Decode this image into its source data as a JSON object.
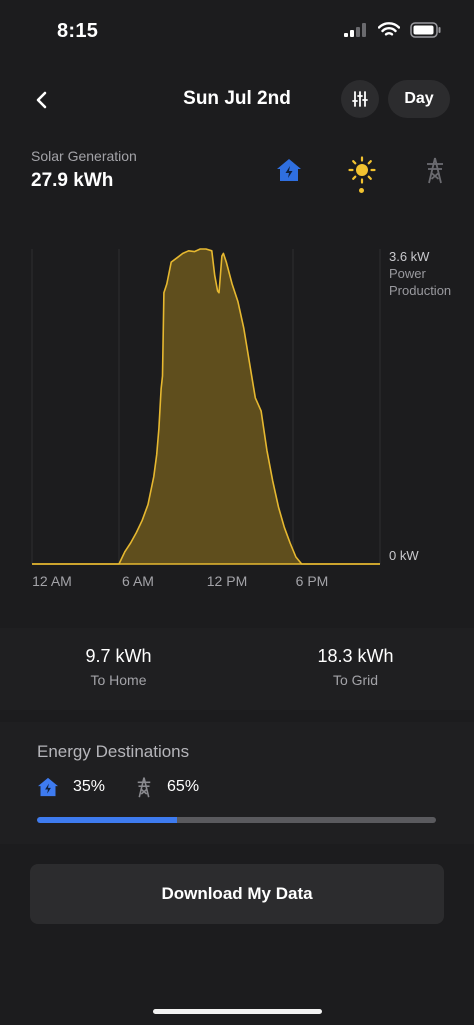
{
  "status_bar": {
    "time": "8:15"
  },
  "nav": {
    "title": "Sun Jul 2nd",
    "period_label": "Day"
  },
  "generation": {
    "label": "Solar Generation",
    "value": "27.9 kWh"
  },
  "chart_data": {
    "type": "area",
    "title": "",
    "xlabel": "",
    "ylabel": "Power Production",
    "x_ticks": [
      "12 AM",
      "6 AM",
      "12 PM",
      "6 PM"
    ],
    "y_ticks": [
      "0 kW",
      "3.6 kW"
    ],
    "ylim": [
      0,
      3.6
    ],
    "xlim": [
      0,
      24
    ],
    "grid": true,
    "colors": {
      "line": "#e6b830",
      "fill": "#5f4e1d",
      "grid": "#2e2e30"
    },
    "series": [
      {
        "x": [
          0,
          6.0,
          6.4,
          6.8,
          7.2,
          7.6,
          8.0,
          8.4,
          8.6,
          8.75,
          8.9,
          9.0,
          9.1,
          9.3,
          9.6,
          10.0,
          10.4,
          10.8,
          11.2,
          11.6,
          12.0,
          12.4,
          12.6,
          12.8,
          12.9,
          13.1,
          13.2,
          13.4,
          13.8,
          14.2,
          14.6,
          15.0,
          15.4,
          15.8,
          16.2,
          16.6,
          17.0,
          17.4,
          17.8,
          18.2,
          18.6,
          19.0,
          24
        ],
        "y": [
          0,
          0,
          0.14,
          0.24,
          0.36,
          0.5,
          0.68,
          1.0,
          1.25,
          1.55,
          2.0,
          2.15,
          3.1,
          3.2,
          3.45,
          3.5,
          3.55,
          3.58,
          3.57,
          3.6,
          3.6,
          3.58,
          3.3,
          3.12,
          3.1,
          3.52,
          3.55,
          3.45,
          3.2,
          3.0,
          2.7,
          2.3,
          1.9,
          1.75,
          1.3,
          0.95,
          0.65,
          0.42,
          0.24,
          0.08,
          0.0,
          0,
          0
        ]
      }
    ]
  },
  "summary": {
    "home": {
      "value": "9.7 kWh",
      "label": "To Home"
    },
    "grid": {
      "value": "18.3 kWh",
      "label": "To Grid"
    }
  },
  "destinations": {
    "title": "Energy Destinations",
    "home_pct": "35%",
    "grid_pct": "65%",
    "home_fraction": 0.35,
    "colors": {
      "home": "#3e7bf0",
      "grid": "#5a5a5e"
    }
  },
  "download": {
    "label": "Download My Data"
  },
  "icons": [
    "back-chevron-icon",
    "filter-icon",
    "home-icon",
    "sun-icon",
    "grid-tower-icon",
    "signal-icon",
    "wifi-icon",
    "battery-icon"
  ]
}
